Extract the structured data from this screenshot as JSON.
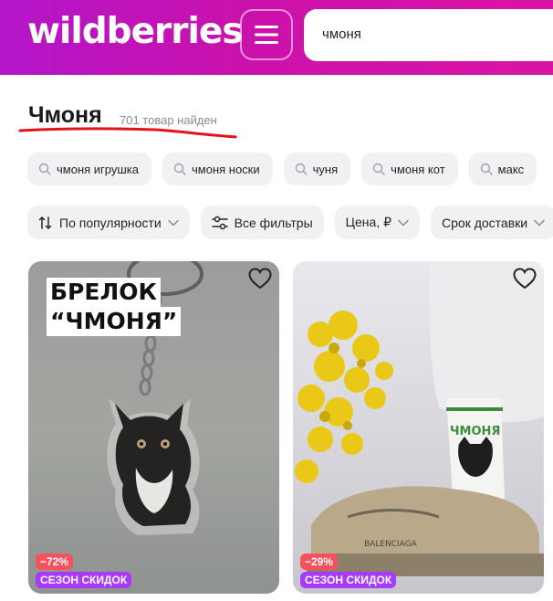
{
  "header": {
    "logo": "wildberries",
    "menu_icon": "hamburger-icon",
    "search_value": "чмоня",
    "colors": {
      "brand_start": "#b316c9",
      "brand_end": "#d914a4"
    }
  },
  "results": {
    "title": "Чмоня",
    "count": "701 товар найден"
  },
  "suggestions": [
    {
      "label": "чмоня игрушка",
      "icon": "search-icon"
    },
    {
      "label": "чмоня носки",
      "icon": "search-icon"
    },
    {
      "label": "чуня",
      "icon": "search-icon"
    },
    {
      "label": "чмоня кот",
      "icon": "search-icon"
    },
    {
      "label": "макс",
      "icon": "search-icon"
    }
  ],
  "filters": [
    {
      "label": "По популярности",
      "icon": "sort-icon",
      "dropdown": true
    },
    {
      "label": "Все фильтры",
      "icon": "sliders-icon",
      "dropdown": false
    },
    {
      "label": "Цена, ₽",
      "icon": "",
      "dropdown": true
    },
    {
      "label": "Срок доставки",
      "icon": "",
      "dropdown": true
    }
  ],
  "products": [
    {
      "image_text_line1": "БРЕЛОК",
      "image_text_line2": "“ЧМОНЯ”",
      "discount": "−72%",
      "badge": "СЕЗОН СКИДОК"
    },
    {
      "image_text": "ЧМОНЯ",
      "shoe_text": "BALENCIAGA",
      "discount": "−29%",
      "badge": "СЕЗОН СКИДОК"
    }
  ],
  "colors": {
    "discount": "#f5515f",
    "season_badge": "#a73afd",
    "underline": "#e0141e"
  }
}
